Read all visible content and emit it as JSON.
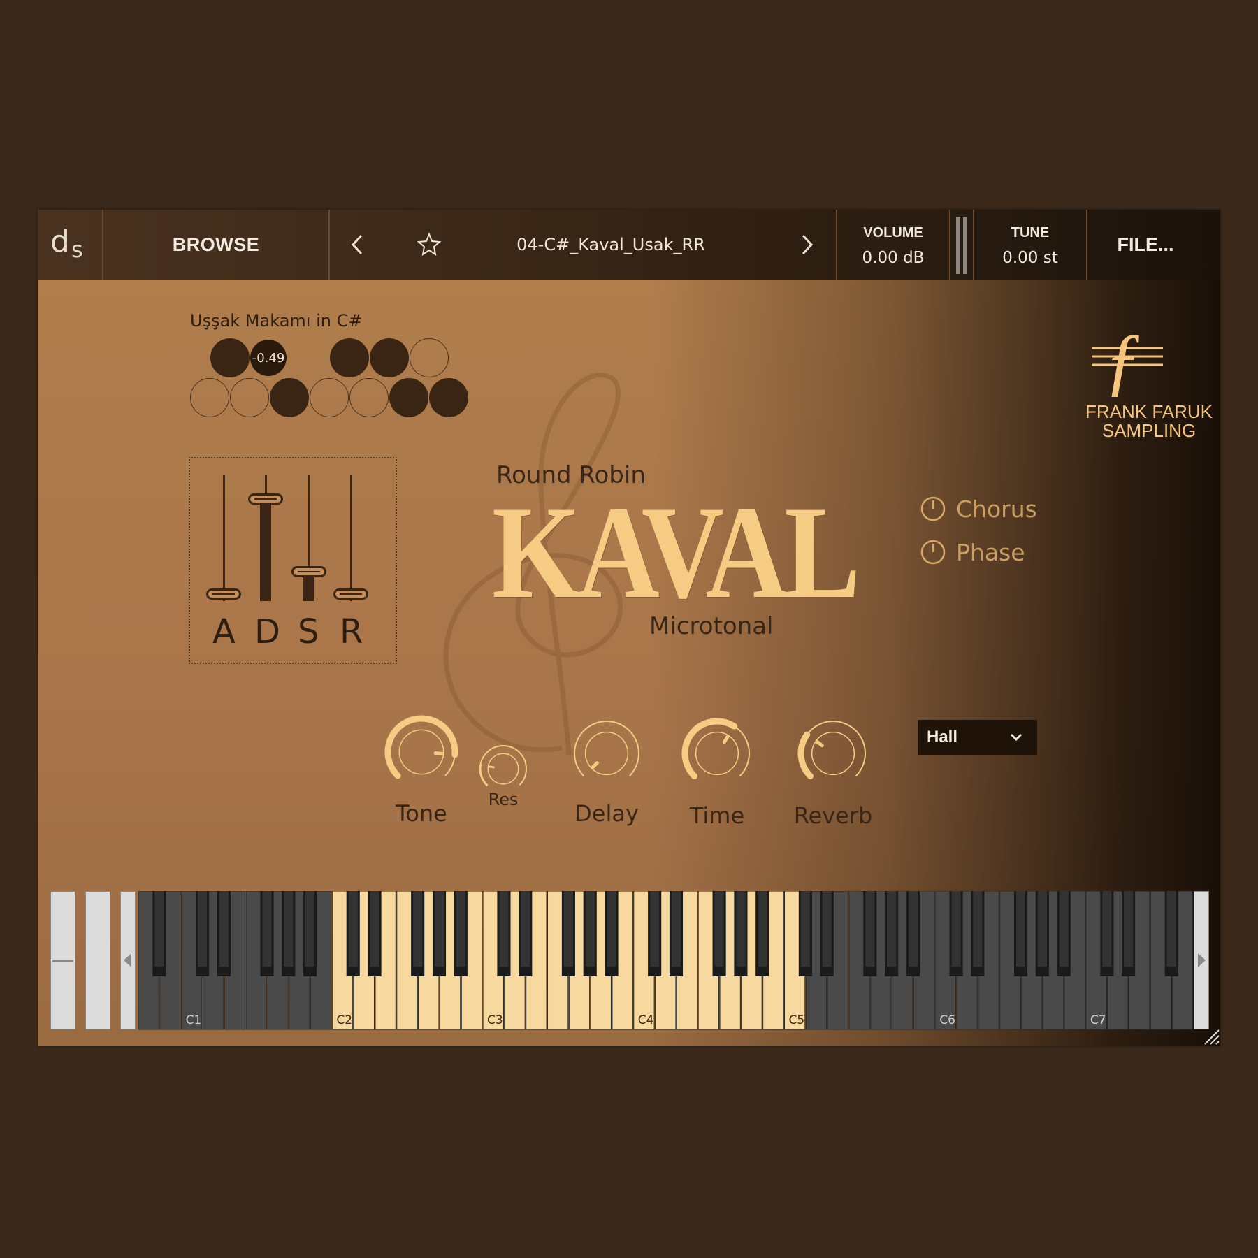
{
  "topbar": {
    "logo_d": "d",
    "logo_s": "s",
    "browse_label": "BROWSE",
    "preset_name": "04-C#_Kaval_Usak_RR",
    "volume_label": "VOLUME",
    "volume_value": "0.00 dB",
    "tune_label": "TUNE",
    "tune_value": "0.00 st",
    "file_label": "FILE..."
  },
  "scale": {
    "title": "Uşşak Makamı in C#",
    "top_row": [
      "filled",
      "tag",
      null,
      "filled",
      "filled",
      "empty"
    ],
    "bottom_row": [
      "empty",
      "empty",
      "filled",
      "empty",
      "empty",
      "filled",
      "filled"
    ],
    "tag_value": "-0.49"
  },
  "adsr": {
    "letters": [
      "A",
      "D",
      "S",
      "R"
    ],
    "levels": [
      0.0,
      0.85,
      0.2,
      0.0
    ]
  },
  "title": {
    "subtitle_top": "Round Robin",
    "main": "KAVAL",
    "subtitle_bottom": "Microtonal"
  },
  "effects": {
    "chorus_label": "Chorus",
    "phase_label": "Phase",
    "reverb_type": "Hall"
  },
  "brand": {
    "line1": "FRANK FARUK",
    "line2": "SAMPLING"
  },
  "knobs": [
    {
      "label": "Tone",
      "value": 0.85
    },
    {
      "label": "Res",
      "value": 0.2
    },
    {
      "label": "Delay",
      "value": 0.0
    },
    {
      "label": "Time",
      "value": 0.62
    },
    {
      "label": "Reverb",
      "value": 0.3
    }
  ],
  "keyboard": {
    "octave_labels": [
      "C1",
      "C2",
      "C3",
      "C4",
      "C5",
      "C6",
      "C7"
    ],
    "active_range": "C2–C5",
    "colors": {
      "active_white": "#f7d9a0",
      "inactive_white": "#4a4a4a",
      "black": "#1a1a1a"
    }
  },
  "colors": {
    "accent": "#f6cc84",
    "panel": "#a8744a",
    "dark": "#3a2515"
  }
}
